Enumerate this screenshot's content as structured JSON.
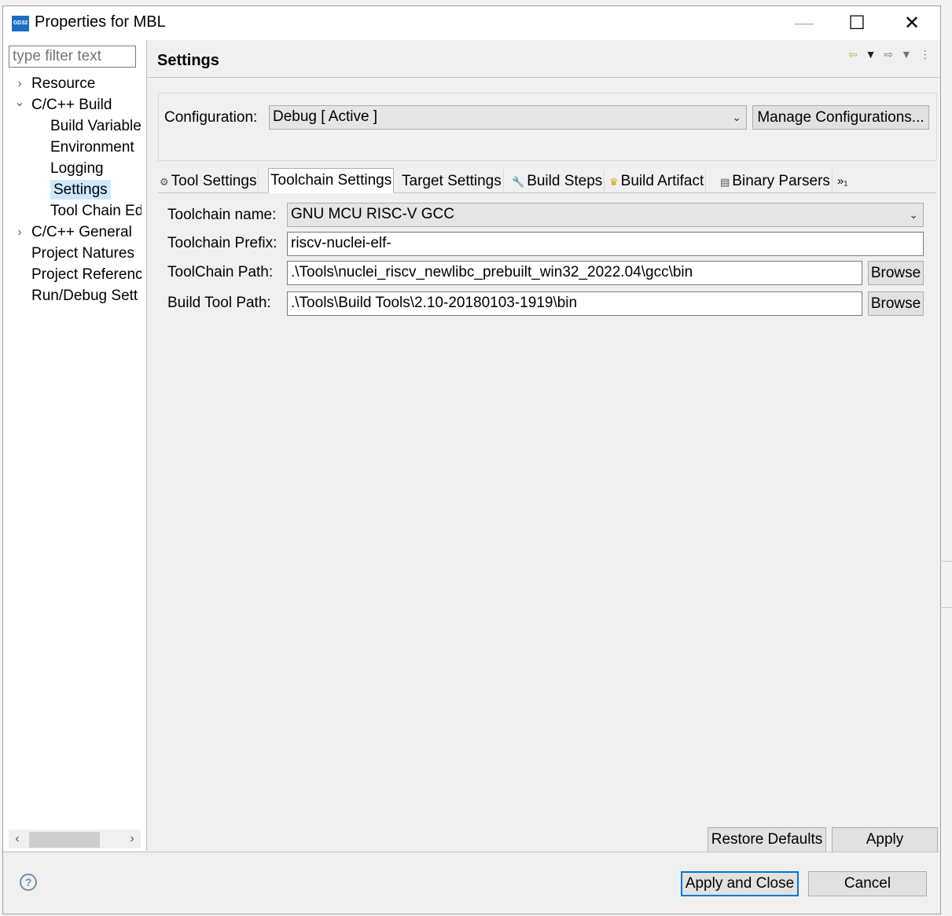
{
  "window": {
    "title": "Properties for MBL",
    "app_icon_text": "GD32",
    "minimize": "—",
    "maximize": "☐",
    "close": "✕"
  },
  "sidebar": {
    "filter_placeholder": "type filter text",
    "items": [
      {
        "label": "Resource",
        "expander": "›"
      },
      {
        "label": "C/C++ Build",
        "expander": "⌄"
      },
      {
        "label": "Build Variable"
      },
      {
        "label": "Environment"
      },
      {
        "label": "Logging"
      },
      {
        "label": "Settings"
      },
      {
        "label": "Tool Chain Ed"
      },
      {
        "label": "C/C++ General",
        "expander": "›"
      },
      {
        "label": "Project Natures"
      },
      {
        "label": "Project Referenc"
      },
      {
        "label": "Run/Debug Sett"
      }
    ],
    "scroll_left": "‹",
    "scroll_right": "›"
  },
  "header": {
    "title": "Settings"
  },
  "configuration": {
    "label": "Configuration:",
    "value": "Debug  [ Active ]",
    "manage_label": "Manage Configurations..."
  },
  "tabs": [
    {
      "label": "Tool Settings",
      "icon": "gear-icon"
    },
    {
      "label": "Toolchain Settings"
    },
    {
      "label": "Target Settings"
    },
    {
      "label": "Build Steps",
      "icon": "wrench-icon"
    },
    {
      "label": "Build Artifact",
      "icon": "trophy-icon"
    },
    {
      "label": "Binary Parsers",
      "icon": "binary-icon"
    },
    {
      "label": "»₁"
    }
  ],
  "form": {
    "toolchain_name_label": "Toolchain name:",
    "toolchain_name_value": "GNU MCU RISC-V GCC",
    "toolchain_prefix_label": "Toolchain Prefix:",
    "toolchain_prefix_value": "riscv-nuclei-elf-",
    "toolchain_path_label": "ToolChain Path:",
    "toolchain_path_value": ".\\Tools\\nuclei_riscv_newlibc_prebuilt_win32_2022.04\\gcc\\bin",
    "build_tool_path_label": "Build Tool Path:",
    "build_tool_path_value": ".\\Tools\\Build Tools\\2.10-20180103-1919\\bin",
    "browse_label": "Browse"
  },
  "actions": {
    "restore_defaults": "Restore Defaults",
    "apply": "Apply",
    "apply_and_close": "Apply and Close",
    "cancel": "Cancel",
    "help": "?"
  }
}
